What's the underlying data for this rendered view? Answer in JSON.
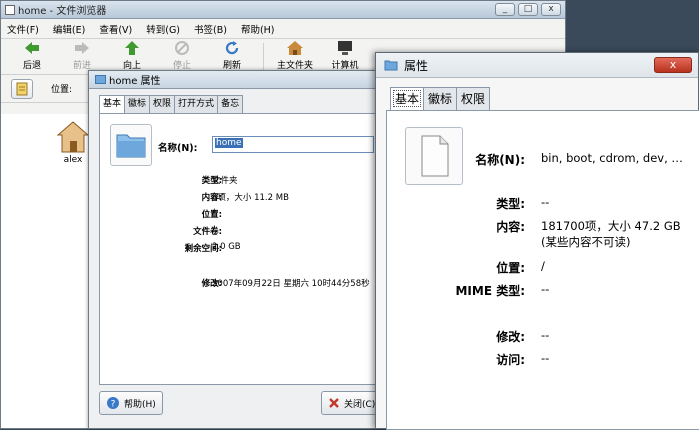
{
  "file_manager": {
    "title": "home - 文件浏览器",
    "window_buttons": [
      "_",
      "□",
      "x"
    ],
    "menu": [
      "文件(F)",
      "编辑(E)",
      "查看(V)",
      "转到(G)",
      "书签(B)",
      "帮助(H)"
    ],
    "toolbar": [
      {
        "label": "后退",
        "icon": "back-arrow-icon"
      },
      {
        "label": "前进",
        "icon": "forward-arrow-icon"
      },
      {
        "label": "向上",
        "icon": "up-arrow-icon"
      },
      {
        "label": "停止",
        "icon": "stop-icon"
      },
      {
        "label": "刷新",
        "icon": "reload-icon"
      },
      {
        "label": "主文件夹",
        "icon": "home-icon"
      },
      {
        "label": "计算机",
        "icon": "computer-icon"
      }
    ],
    "location_label": "位置:",
    "items": [
      {
        "name": "alex",
        "icon": "home-folder-icon"
      }
    ]
  },
  "home_properties": {
    "title": "home 属性",
    "tabs": [
      "基本",
      "徽标",
      "权限",
      "打开方式",
      "备忘"
    ],
    "name_label": "名称(N):",
    "name_value": "home",
    "fields": [
      {
        "label": "类型:",
        "value": "文件夹"
      },
      {
        "label": "内容:",
        "value": "6项，大小 11.2 MB"
      },
      {
        "label": "位置:",
        "value": "/"
      },
      {
        "label": "文件卷:",
        "value": "/"
      },
      {
        "label": "剩余空间:",
        "value": "2.0 GB"
      },
      {
        "label": "修改:",
        "value": "2007年09月22日 星期六 10时44分58秒"
      }
    ],
    "help_button": "帮助(H)",
    "close_button": "关闭(C)"
  },
  "multi_properties": {
    "title": "属性",
    "close_button": "x",
    "tabs": [
      "基本",
      "徽标",
      "权限"
    ],
    "name_label": "名称(N):",
    "name_value": "bin, boot, cdrom, dev, …",
    "fields": [
      {
        "label": "类型:",
        "value": "--"
      },
      {
        "label": "内容:",
        "value": "181700项，大小 47.2 GB",
        "value2": "(某些内容不可读)"
      },
      {
        "label": "位置:",
        "value": "/"
      },
      {
        "label": "MIME 类型:",
        "value": "--"
      },
      {
        "label": "修改:",
        "value": "--"
      },
      {
        "label": "访问:",
        "value": "--"
      }
    ]
  },
  "colors": {
    "accent": "#3b6fb6",
    "close_red": "#c0392b"
  }
}
